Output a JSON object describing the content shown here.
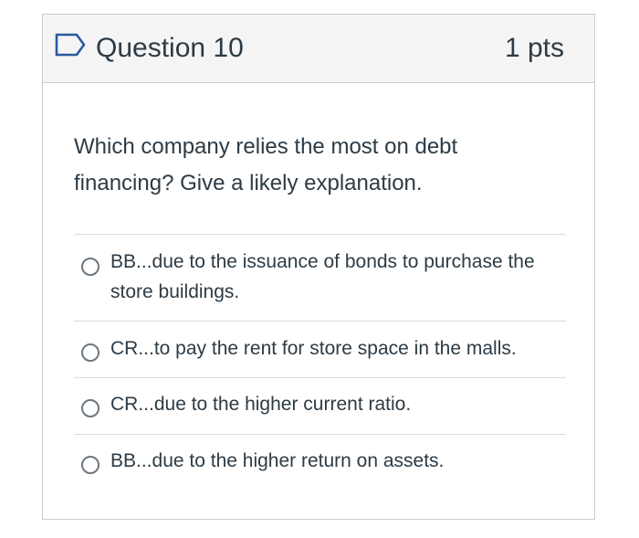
{
  "question": {
    "title": "Question 10",
    "points": "1 pts",
    "flag_icon": "bookmark-flag-icon",
    "text": "Which company relies the most on debt financing?  Give a likely explanation."
  },
  "answers": [
    {
      "label": "BB...due to the issuance of bonds to purchase the store buildings.",
      "selected": false
    },
    {
      "label": "CR...to pay the rent for store space in the malls.",
      "selected": false
    },
    {
      "label": "CR...due to the higher current ratio.",
      "selected": false
    },
    {
      "label": "BB...due to the higher return on assets.",
      "selected": false
    }
  ],
  "colors": {
    "text": "#2d3b45",
    "header_background": "#f5f5f5",
    "border": "#c7cdd1",
    "divider": "#d7dbde",
    "radio_border": "#6b7780"
  }
}
